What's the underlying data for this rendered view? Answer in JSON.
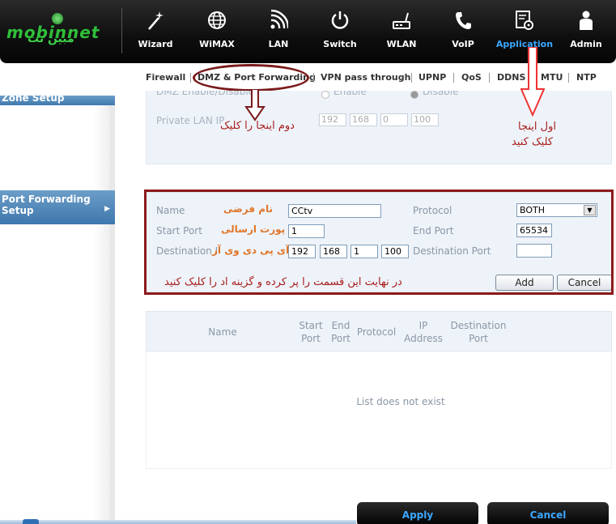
{
  "brand": {
    "logo_text": "mobinnet",
    "logo_text_fa": "مبین نت"
  },
  "nav": {
    "items": [
      {
        "label": "Wizard",
        "icon": "wand-icon"
      },
      {
        "label": "WiMAX",
        "icon": "globe-icon"
      },
      {
        "label": "LAN",
        "icon": "signal-icon"
      },
      {
        "label": "Switch",
        "icon": "power-icon"
      },
      {
        "label": "WLAN",
        "icon": "router-icon"
      },
      {
        "label": "VoIP",
        "icon": "phone-icon"
      },
      {
        "label": "Application",
        "icon": "settings-page-icon",
        "active": true
      },
      {
        "label": "Admin",
        "icon": "user-icon"
      }
    ],
    "active_color": "#3aa7ff"
  },
  "subtabs": [
    "Firewall",
    "DMZ & Port Forwarding",
    "VPN pass through",
    "UPNP",
    "QoS",
    "DDNS",
    "MTU",
    "NTP"
  ],
  "sidebar": {
    "zone_setup": "Zone Setup",
    "port_forwarding": "Port Forwarding Setup"
  },
  "dmz": {
    "enable_label": "DMZ Enable/Disable",
    "enable_option": "Enable",
    "disable_option": "Disable",
    "private_ip_label": "Private LAN IP",
    "ip": [
      "192",
      "168",
      "0",
      "100"
    ]
  },
  "pf_form": {
    "name_label": "Name",
    "name_value": "CCtv",
    "protocol_label": "Protocol",
    "protocol_value": "BOTH",
    "start_port_label": "Start Port",
    "start_port_value": "1",
    "end_port_label": "End Port",
    "end_port_value": "65534",
    "dest_ip_label": "Destination IP",
    "dest_ip": [
      "192",
      "168",
      "1",
      "100"
    ],
    "dest_port_label": "Destination Port",
    "dest_port_value": "",
    "add_button": "Add",
    "cancel_button": "Cancel"
  },
  "table": {
    "headers": [
      "Name",
      "Start Port",
      "End Port",
      "Protocol",
      "IP Address",
      "Destination Port"
    ],
    "empty_message": "List does not exist"
  },
  "footer": {
    "apply_button": "Apply",
    "cancel_button": "Cancel"
  },
  "annotations": {
    "step1_line1": "اول اینجا",
    "step1_line2": "کلیک کنید",
    "step2": "دوم اینجا را کلیک",
    "name_hint": "نام فرضی",
    "port_hint": "پورت ارسالی",
    "ip_hint": "آی پی دی وی آر",
    "final": "در نهایت این قسمت را پر کرده و گزینه اد را کلیک کنید"
  },
  "colors": {
    "annotation_red": "#a81c1c",
    "annotation_orange": "#e0762a",
    "highlight_frame": "#8b1a1a"
  }
}
